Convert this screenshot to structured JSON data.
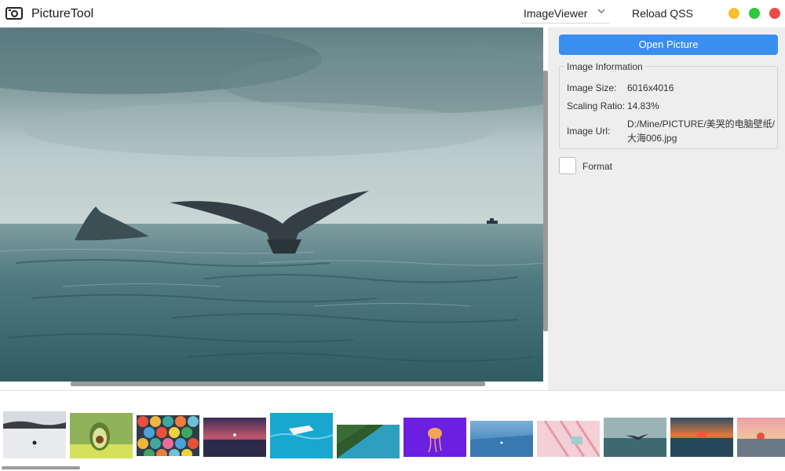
{
  "app": {
    "title": "PictureTool",
    "icon": "camera-icon"
  },
  "toolbar": {
    "viewer_select_value": "ImageViewer",
    "reload_label": "Reload QSS"
  },
  "window_controls": {
    "minimize_color": "#f5bf2e",
    "maximize_color": "#2dc83f",
    "close_color": "#f14a47"
  },
  "panel": {
    "open_button_label": "Open Picture",
    "info_title": "Image Information",
    "image_size_label": "Image Size:",
    "image_size_value": "6016x4016",
    "scaling_ratio_label": "Scaling Ratio:",
    "scaling_ratio_value": "14.83%",
    "image_url_label": "Image Url:",
    "image_url_line1": "D:/Mine/PICTURE/美哭的电脑壁纸/",
    "image_url_line2": "大海006.jpg",
    "format_label": "Format",
    "format_checked": false
  },
  "colors": {
    "accent": "#3a8ef0",
    "panel_bg": "#eeeeee"
  }
}
